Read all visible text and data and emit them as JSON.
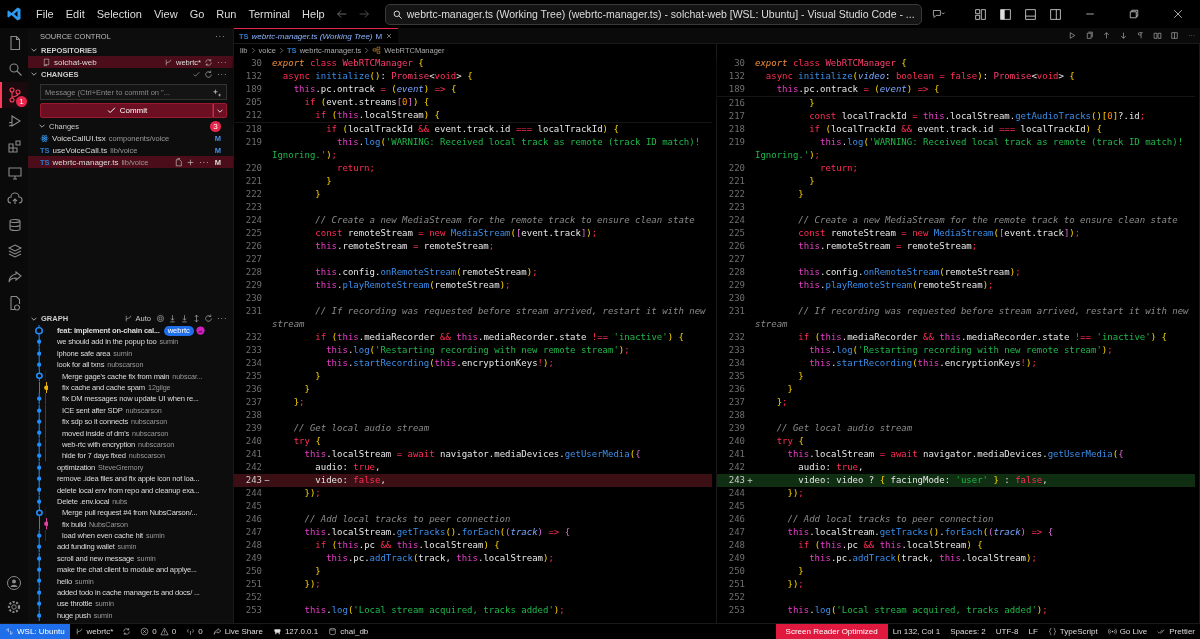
{
  "title_bar": {
    "menu": [
      "File",
      "Edit",
      "Selection",
      "View",
      "Go",
      "Run",
      "Terminal",
      "Help"
    ],
    "search": "webrtc-manager.ts (Working Tree) (webrtc-manager.ts) - solchat-web [WSL: Ubuntu] - Visual Studio Code - ..."
  },
  "activity_bar": {
    "items": [
      {
        "selected": false
      },
      {
        "selected": false
      },
      {
        "selected": true,
        "badge": "1"
      },
      {
        "selected": false
      },
      {
        "selected": false
      },
      {
        "selected": false
      },
      {
        "selected": false
      },
      {
        "selected": false
      },
      {
        "selected": false
      },
      {
        "selected": false
      },
      {
        "selected": false
      }
    ]
  },
  "sidebar": {
    "title": "SOURCE CONTROL",
    "repositories": {
      "title": "REPOSITORIES",
      "expanded": true,
      "repo": {
        "name": "solchat-web",
        "branch": "webrtc*",
        "selected": true
      }
    },
    "changes": {
      "title": "CHANGES",
      "expanded": true,
      "placeholder": "Message (Ctrl+Enter to commit on \"...",
      "commit": "Commit",
      "group": {
        "label": "Changes",
        "count": "3",
        "expanded": true,
        "files": [
          {
            "kind": "react",
            "name": "VoiceCallUI.tsx",
            "path": "components/voice",
            "status": "M",
            "selected": false
          },
          {
            "kind": "ts",
            "icon_label": "TS",
            "name": "useVoiceCall.ts",
            "path": "lib/voice",
            "status": "M",
            "selected": false
          },
          {
            "kind": "ts",
            "icon_label": "TS",
            "name": "webrtc-manager.ts",
            "path": "lib/voice",
            "status": "M",
            "selected": true
          }
        ]
      }
    },
    "graph": {
      "title": "GRAPH",
      "expanded": true,
      "mode": "Auto",
      "commits": [
        {
          "kind": "head",
          "message": "feat: implement on-chain cal...",
          "badge": "webrtc",
          "color": "#1f8fff",
          "nested": false
        },
        {
          "kind": "commit",
          "message": "we should add in the popup too",
          "author": "sumin",
          "color": "#1f8fff",
          "nested": false
        },
        {
          "kind": "commit",
          "message": "iphone safe area",
          "author": "sumin",
          "color": "#1f8fff",
          "nested": false
        },
        {
          "kind": "commit",
          "message": "look for all txns",
          "author": "nubscarson",
          "color": "#1f8fff",
          "nested": false
        },
        {
          "kind": "merge",
          "message": "Merge gage's cache fix from main",
          "author": "nubscar...",
          "color": "#1f8fff",
          "nested": true
        },
        {
          "kind": "side",
          "message": "fix cache and cache spam",
          "author": "12gilge",
          "color": "#f0b400",
          "nested": true
        },
        {
          "kind": "commit",
          "message": "fix DM messages now update UI when re...",
          "color": "#1f8fff",
          "nested": true
        },
        {
          "kind": "commit",
          "message": "ICE sent after SDP",
          "author": "nubscarson",
          "color": "#1f8fff",
          "nested": true
        },
        {
          "kind": "commit",
          "message": "fix sdp so it connects",
          "author": "nubscarson",
          "color": "#1f8fff",
          "nested": true
        },
        {
          "kind": "commit",
          "message": "moved inside of dm's",
          "author": "nubscarson",
          "color": "#1f8fff",
          "nested": true
        },
        {
          "kind": "commit",
          "message": "web-rtc with encryption",
          "author": "nubscarson",
          "color": "#1f8fff",
          "nested": true
        },
        {
          "kind": "commit",
          "message": "hide for 7 days fixed",
          "author": "nubscarson",
          "color": "#1f8fff",
          "nested": true
        },
        {
          "kind": "commit",
          "message": "optimization",
          "author": "SteveGremory",
          "color": "#1f8fff",
          "nested": false
        },
        {
          "kind": "commit",
          "message": "remove .idea files and fix apple icon not loa...",
          "color": "#1f8fff",
          "nested": false
        },
        {
          "kind": "commit",
          "message": "delete local env from repo and cleanup exa...",
          "color": "#1f8fff",
          "nested": false
        },
        {
          "kind": "commit",
          "message": "Delete .env.local",
          "author": "nubs",
          "color": "#1f8fff",
          "nested": false
        },
        {
          "kind": "merge",
          "message": "Merge pull request #4 from NubsCarson/...",
          "color": "#1f8fff",
          "nested": true
        },
        {
          "kind": "side",
          "message": "fix build",
          "author": "NubsCarson",
          "color": "#e0409f",
          "nested": true
        },
        {
          "kind": "commit",
          "message": "load when even cache hit",
          "author": "sumin",
          "color": "#1f8fff",
          "nested": true
        },
        {
          "kind": "commit",
          "message": "add funding wallet",
          "author": "sumin",
          "color": "#1f8fff",
          "nested": false
        },
        {
          "kind": "commit",
          "message": "scroll and new message",
          "author": "sumin",
          "color": "#1f8fff",
          "nested": false
        },
        {
          "kind": "commit",
          "message": "make the chat client to module and applye...",
          "color": "#1f8fff",
          "nested": false
        },
        {
          "kind": "commit",
          "message": "hello",
          "author": "sumin",
          "color": "#1f8fff",
          "nested": false
        },
        {
          "kind": "commit",
          "message": "added todo in cache manager.ts and docs/ ...",
          "color": "#1f8fff",
          "nested": false
        },
        {
          "kind": "commit",
          "message": "use throttle",
          "author": "sumin",
          "color": "#1f8fff",
          "nested": false
        },
        {
          "kind": "commit",
          "message": "huge push",
          "author": "sumin",
          "color": "#1f8fff",
          "nested": false
        }
      ]
    }
  },
  "editor": {
    "tab": {
      "icon_label": "TS",
      "title": "webrtc-manager.ts (Working Tree)",
      "status": "M",
      "selected": true
    },
    "panes": [
      {
        "breadcrumb": [
          {
            "kind": "folder",
            "text": "lib"
          },
          {
            "kind": "folder",
            "text": "voice"
          },
          {
            "kind": "file",
            "icon_label": "TS",
            "text": "webrtc-manager.ts"
          },
          {
            "kind": "class",
            "text": "WebRTCManager"
          }
        ],
        "sticky": [
          {
            "n": "30",
            "code": "export class WebRTCManager {"
          },
          {
            "n": "132",
            "code": "  async initialize(): Promise<void> {"
          },
          {
            "n": "189",
            "code": "    this.pc.ontrack = (event) => {"
          },
          {
            "n": "205",
            "code": "      if (event.streams[0]) {"
          },
          {
            "n": "212",
            "code": "        if (this.localStream) {"
          }
        ],
        "lines": [
          {
            "n": "218",
            "code": "          if (localTrackId && event.track.id === localTrackId) {"
          },
          {
            "n": "219",
            "code": "            this.log('WARNING: Received local track as remote (track ID match)!"
          },
          {
            "kind": "wrap-string",
            "code": "Ignoring.');"
          },
          {
            "n": "220",
            "code": "            return;"
          },
          {
            "n": "221",
            "code": "          }"
          },
          {
            "n": "222",
            "code": "        }"
          },
          {
            "n": "223"
          },
          {
            "n": "224",
            "code": "        // Create a new MediaStream for the remote track to ensure clean state"
          },
          {
            "n": "225",
            "code": "        const remoteStream = new MediaStream([event.track]);"
          },
          {
            "n": "226",
            "code": "        this.remoteStream = remoteStream;"
          },
          {
            "n": "227"
          },
          {
            "n": "228",
            "code": "        this.config.onRemoteStream(remoteStream);"
          },
          {
            "n": "229",
            "code": "        this.playRemoteStream(remoteStream);"
          },
          {
            "n": "230"
          },
          {
            "n": "231",
            "code": "        // If recording was requested before stream arrived, restart it with new"
          },
          {
            "kind": "wrap-comment",
            "code": "stream"
          },
          {
            "n": "232",
            "code": "        if (this.mediaRecorder && this.mediaRecorder.state !== 'inactive') {"
          },
          {
            "n": "233",
            "code": "          this.log('Restarting recording with new remote stream');"
          },
          {
            "n": "234",
            "code": "          this.startRecording(this.encryptionKeys!);"
          },
          {
            "n": "235",
            "code": "        }"
          },
          {
            "n": "236",
            "code": "      }"
          },
          {
            "n": "237",
            "code": "    };"
          },
          {
            "n": "238"
          },
          {
            "n": "239",
            "code": "    // Get local audio stream"
          },
          {
            "n": "240",
            "code": "    try {"
          },
          {
            "n": "241",
            "code": "      this.localStream = await navigator.mediaDevices.getUserMedia({"
          },
          {
            "n": "242",
            "code": "        audio: true,"
          },
          {
            "n": "243",
            "kind": "removed",
            "marker": "−",
            "code": "        video: false,"
          },
          {
            "n": "244",
            "code": "      });"
          },
          {
            "n": "245"
          },
          {
            "n": "246",
            "code": "      // Add local tracks to peer connection"
          },
          {
            "n": "247",
            "code": "      this.localStream.getTracks().forEach((track) => {"
          },
          {
            "n": "248",
            "code": "        if (this.pc && this.localStream) {"
          },
          {
            "n": "249",
            "code": "          this.pc.addTrack(track, this.localStream);"
          },
          {
            "n": "250",
            "code": "        }"
          },
          {
            "n": "251",
            "code": "      });"
          },
          {
            "n": "252"
          },
          {
            "n": "253",
            "code": "      this.log('Local stream acquired, tracks added');"
          }
        ]
      },
      {
        "sticky": [
          {
            "n": "30",
            "code": "export class WebRTCManager {"
          },
          {
            "n": "132",
            "code": "  async initialize(video: boolean = false): Promise<void> {"
          },
          {
            "n": "189",
            "code": "    this.pc.ontrack = (event) => {"
          }
        ],
        "lines": [
          {
            "n": "216",
            "code": "          }"
          },
          {
            "n": "217",
            "code": "          const localTrackId = this.localStream.getAudioTracks()[0]?.id;"
          },
          {
            "n": "218",
            "code": "          if (localTrackId && event.track.id === localTrackId) {"
          },
          {
            "n": "219",
            "code": "            this.log('WARNING: Received local track as remote (track ID match)!"
          },
          {
            "kind": "wrap-string",
            "code": "Ignoring.');"
          },
          {
            "n": "220",
            "code": "            return;"
          },
          {
            "n": "221",
            "code": "          }"
          },
          {
            "n": "222",
            "code": "        }"
          },
          {
            "n": "223"
          },
          {
            "n": "224",
            "code": "        // Create a new MediaStream for the remote track to ensure clean state"
          },
          {
            "n": "225",
            "code": "        const remoteStream = new MediaStream([event.track]);"
          },
          {
            "n": "226",
            "code": "        this.remoteStream = remoteStream;"
          },
          {
            "n": "227"
          },
          {
            "n": "228",
            "code": "        this.config.onRemoteStream(remoteStream);"
          },
          {
            "n": "229",
            "code": "        this.playRemoteStream(remoteStream);"
          },
          {
            "n": "230"
          },
          {
            "n": "231",
            "code": "        // If recording was requested before stream arrived, restart it with new"
          },
          {
            "kind": "wrap-comment",
            "code": "stream"
          },
          {
            "n": "232",
            "code": "        if (this.mediaRecorder && this.mediaRecorder.state !== 'inactive') {"
          },
          {
            "n": "233",
            "code": "          this.log('Restarting recording with new remote stream');"
          },
          {
            "n": "234",
            "code": "          this.startRecording(this.encryptionKeys!);"
          },
          {
            "n": "235",
            "code": "        }"
          },
          {
            "n": "236",
            "code": "      }"
          },
          {
            "n": "237",
            "code": "    };"
          },
          {
            "n": "238"
          },
          {
            "n": "239",
            "code": "    // Get local audio stream"
          },
          {
            "n": "240",
            "code": "    try {"
          },
          {
            "n": "241",
            "code": "      this.localStream = await navigator.mediaDevices.getUserMedia({"
          },
          {
            "n": "242",
            "code": "        audio: true,"
          },
          {
            "n": "243",
            "kind": "added",
            "marker": "+",
            "code": "        video: video ? { facingMode: 'user' } : false,"
          },
          {
            "n": "244",
            "code": "      });"
          },
          {
            "n": "245"
          },
          {
            "n": "246",
            "code": "      // Add local tracks to peer connection"
          },
          {
            "n": "247",
            "code": "      this.localStream.getTracks().forEach((track) => {"
          },
          {
            "n": "248",
            "code": "        if (this.pc && this.localStream) {"
          },
          {
            "n": "249",
            "code": "          this.pc.addTrack(track, this.localStream);"
          },
          {
            "n": "250",
            "code": "        }"
          },
          {
            "n": "251",
            "code": "      });"
          },
          {
            "n": "252"
          },
          {
            "n": "253",
            "code": "      this.log('Local stream acquired, tracks added');"
          }
        ]
      }
    ]
  },
  "status_bar": {
    "left": [
      {
        "kind": "remote",
        "text": "WSL: Ubuntu"
      },
      {
        "kind": "branch",
        "text": "webrtc*"
      },
      {
        "kind": "sync"
      },
      {
        "kind": "problems",
        "errors": "0",
        "warnings": "0"
      },
      {
        "kind": "ports",
        "text": "0"
      },
      {
        "kind": "liveshare",
        "text": "Live Share"
      },
      {
        "kind": "server",
        "text": "127.0.0.1"
      },
      {
        "kind": "database",
        "text": "chai_db"
      }
    ],
    "right": [
      {
        "kind": "alert",
        "text": "Screen Reader Optimized"
      },
      {
        "kind": "text",
        "text": "Ln 132, Col 1"
      },
      {
        "kind": "text",
        "text": "Spaces: 2"
      },
      {
        "kind": "text",
        "text": "UTF-8"
      },
      {
        "kind": "text",
        "text": "LF"
      },
      {
        "kind": "language",
        "text": "TypeScript"
      },
      {
        "kind": "golive",
        "text": "Go Live"
      },
      {
        "kind": "prettier",
        "text": "Prettier"
      }
    ]
  }
}
